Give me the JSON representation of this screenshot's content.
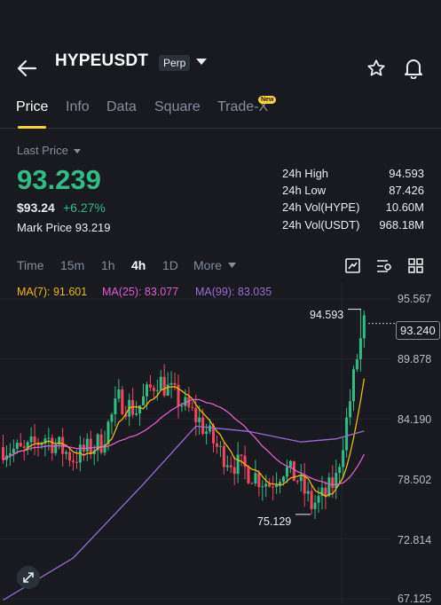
{
  "header": {
    "title": "HYPEUSDT",
    "badge": "Perp",
    "colors": {
      "background": "#181a20",
      "accent": "#fcd535",
      "up": "#2ebd85",
      "down": "#f6465d"
    }
  },
  "tabs": [
    {
      "label": "Price",
      "active": true
    },
    {
      "label": "Info"
    },
    {
      "label": "Data"
    },
    {
      "label": "Square"
    },
    {
      "label": "Trade-X",
      "badge": "New"
    }
  ],
  "price": {
    "last_label": "Last Price",
    "last_value": "93.239",
    "usd_value": "$93.24",
    "change": "+6.27%",
    "mark_label": "Mark Price",
    "mark_value": "93.219"
  },
  "stats": [
    {
      "label": "24h High",
      "value": "94.593"
    },
    {
      "label": "24h Low",
      "value": "87.426"
    },
    {
      "label": "24h Vol(HYPE)",
      "value": "10.60M"
    },
    {
      "label": "24h Vol(USDT)",
      "value": "968.18M"
    }
  ],
  "intervals": [
    {
      "label": "Time"
    },
    {
      "label": "15m"
    },
    {
      "label": "1h"
    },
    {
      "label": "4h",
      "active": true
    },
    {
      "label": "1D"
    },
    {
      "label": "More"
    }
  ],
  "toolbar_icons": [
    "indicator-icon",
    "settings-icon",
    "layout-grid-icon"
  ],
  "chart": {
    "ma": [
      {
        "label": "MA(7): 91.601",
        "color": "#f0b90b"
      },
      {
        "label": "MA(25): 83.077",
        "color": "#e15ecc"
      },
      {
        "label": "MA(99): 83.035",
        "color": "#9b6cd6"
      }
    ],
    "y_labels": [
      "95.567",
      "89.878",
      "84.190",
      "78.502",
      "72.814",
      "67.125"
    ],
    "current_price": "93.240",
    "high_annotation": "94.593",
    "low_annotation": "75.129"
  },
  "chart_data": {
    "type": "candlestick",
    "ylim": [
      67.125,
      95.567
    ],
    "y_ticks": [
      95.567,
      89.878,
      84.19,
      78.502,
      72.814,
      67.125
    ],
    "series": [
      {
        "name": "MA(7)",
        "last": 91.601
      },
      {
        "name": "MA(25)",
        "last": 83.077
      },
      {
        "name": "MA(99)",
        "last": 83.035
      }
    ],
    "annotations": {
      "high": 94.593,
      "low": 75.129,
      "current": 93.24
    }
  }
}
